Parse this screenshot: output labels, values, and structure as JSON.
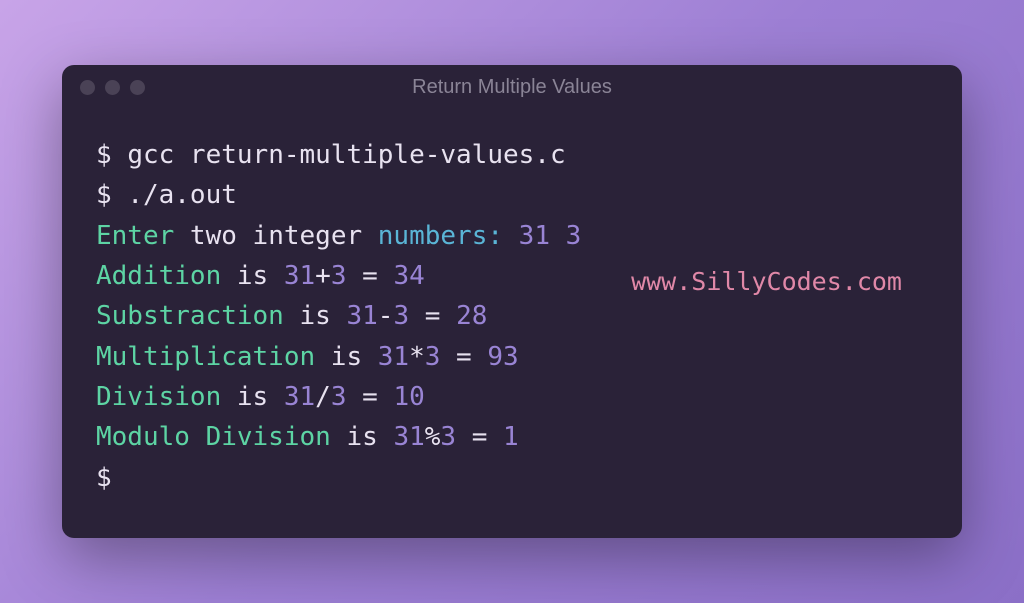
{
  "window": {
    "title": "Return Multiple Values"
  },
  "watermark": "www.SillyCodes.com",
  "terminal": {
    "prompt": "$",
    "cmd1": "gcc return-multiple-values.c",
    "cmd2": "./a.out",
    "enter_label": "Enter",
    "two_integer": " two integer ",
    "numbers_label": "numbers:",
    "input_vals": " 31 3",
    "addition_label": "Addition",
    "is_label": " is ",
    "add_a": "31",
    "plus_op": "+",
    "add_b": "3",
    "equals": " = ",
    "add_result": "34",
    "sub_label": "Substraction",
    "sub_a": "31",
    "minus_op": "-",
    "sub_b": "3",
    "sub_result": "28",
    "mul_label": "Multiplication",
    "mul_a": "31",
    "star_op": "*",
    "mul_b": "3",
    "mul_result": "93",
    "div_label": "Division",
    "div_a": "31",
    "slash_op": "/",
    "div_b": "3",
    "div_result": "10",
    "mod_label": "Modulo Division",
    "mod_a": "31",
    "pct_op": "%",
    "mod_b": "3",
    "mod_result": "1"
  }
}
